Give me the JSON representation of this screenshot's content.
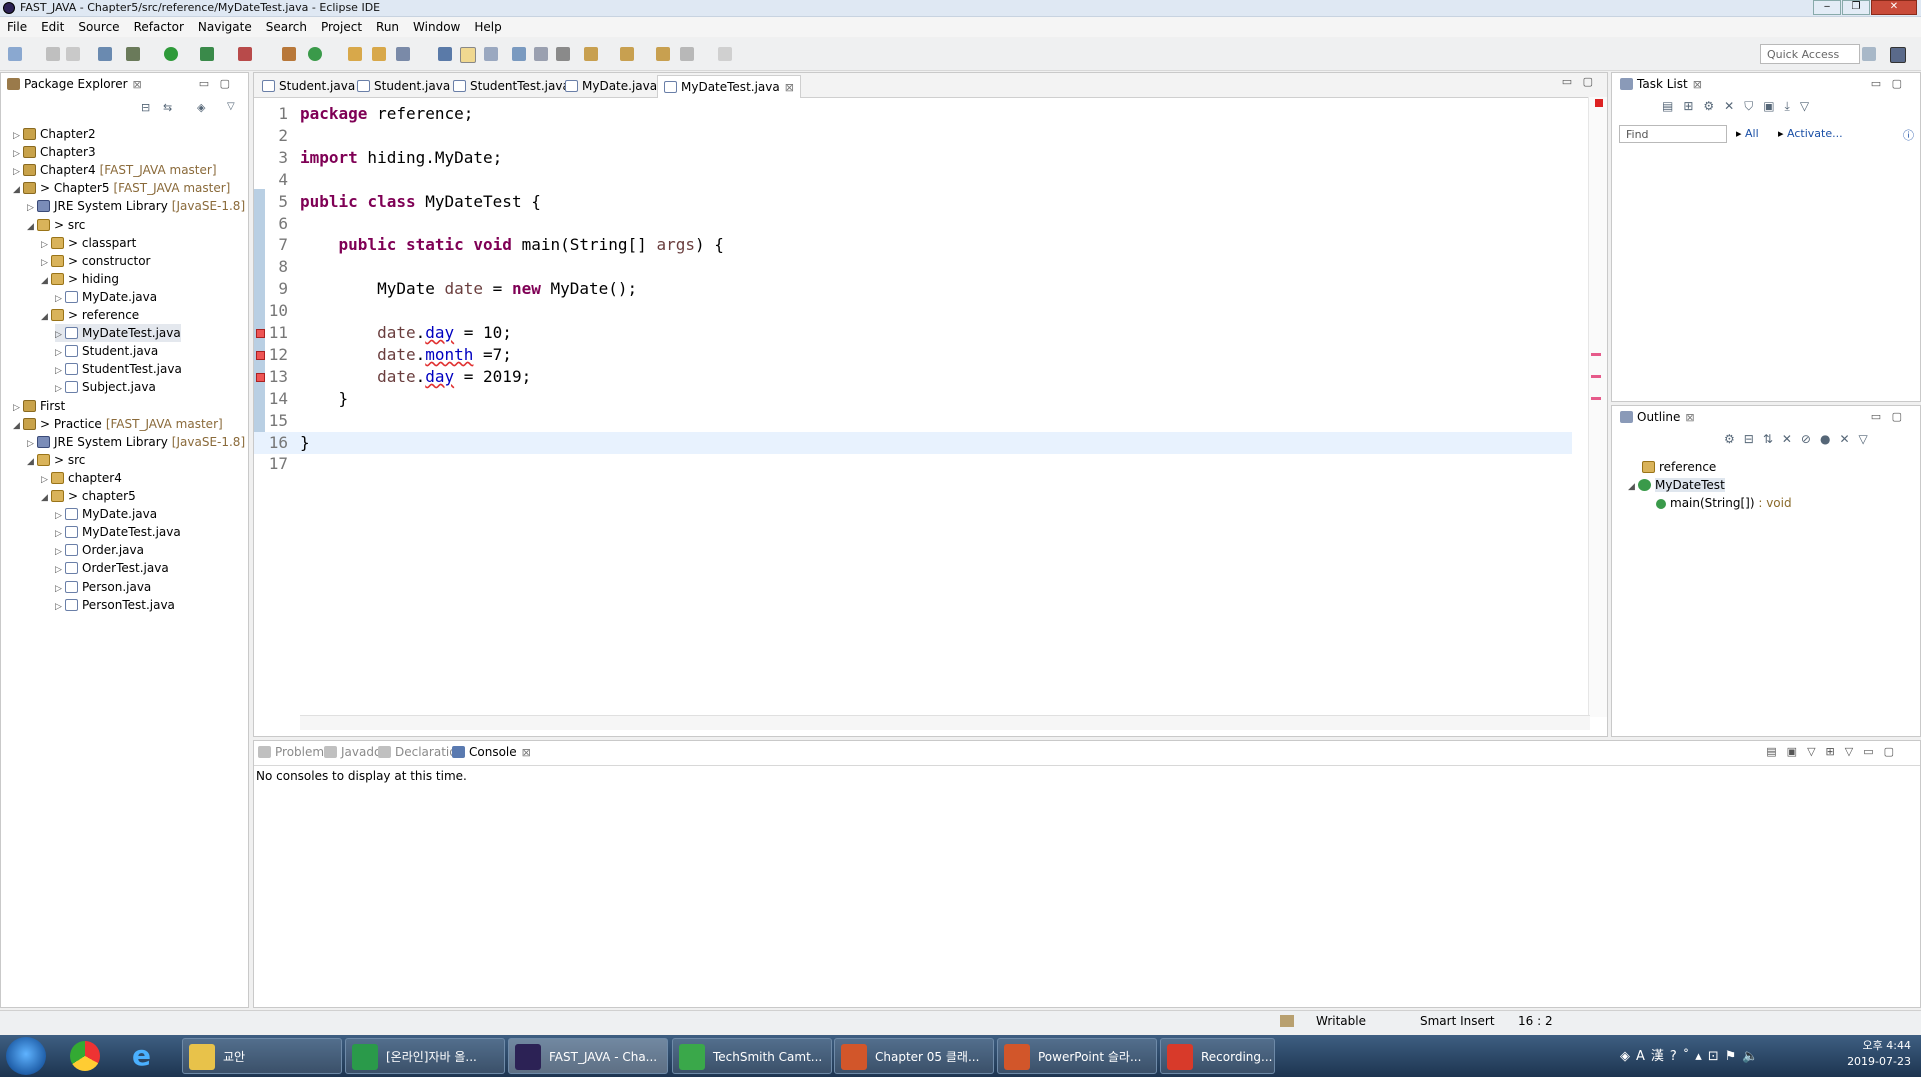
{
  "window": {
    "title": "FAST_JAVA - Chapter5/src/reference/MyDateTest.java - Eclipse IDE"
  },
  "menu": [
    "File",
    "Edit",
    "Source",
    "Refactor",
    "Navigate",
    "Search",
    "Project",
    "Run",
    "Window",
    "Help"
  ],
  "toolbar": {
    "quick_access": "Quick Access"
  },
  "package_explorer": {
    "title": "Package Explorer",
    "rows": [
      {
        "label": "Chapter2",
        "extra": "",
        "icon": "project-icon",
        "depth": 0,
        "twisty": "▷"
      },
      {
        "label": "Chapter3",
        "extra": "",
        "icon": "project-icon",
        "depth": 0,
        "twisty": "▷"
      },
      {
        "label": "Chapter4",
        "extra": "[FAST_JAVA master]",
        "icon": "project-icon",
        "depth": 0,
        "twisty": "▷"
      },
      {
        "label": "> Chapter5",
        "extra": "[FAST_JAVA master]",
        "icon": "project-icon",
        "depth": 0,
        "twisty": "◢"
      },
      {
        "label": "JRE System Library",
        "extra": "[JavaSE-1.8]",
        "icon": "library-icon",
        "depth": 1,
        "twisty": "▷"
      },
      {
        "label": "> src",
        "extra": "",
        "icon": "package-icon",
        "depth": 1,
        "twisty": "◢"
      },
      {
        "label": "> classpart",
        "extra": "",
        "icon": "package-icon",
        "depth": 2,
        "twisty": "▷"
      },
      {
        "label": "> constructor",
        "extra": "",
        "icon": "package-icon",
        "depth": 2,
        "twisty": "▷"
      },
      {
        "label": "> hiding",
        "extra": "",
        "icon": "package-icon",
        "depth": 2,
        "twisty": "◢"
      },
      {
        "label": "MyDate.java",
        "extra": "",
        "icon": "java-file-icon",
        "depth": 3,
        "twisty": "▷"
      },
      {
        "label": "> reference",
        "extra": "",
        "icon": "package-icon",
        "depth": 2,
        "twisty": "◢"
      },
      {
        "label": "MyDateTest.java",
        "extra": "",
        "icon": "java-file-icon",
        "depth": 3,
        "twisty": "▷"
      },
      {
        "label": "Student.java",
        "extra": "",
        "icon": "java-file-icon",
        "depth": 3,
        "twisty": "▷"
      },
      {
        "label": "StudentTest.java",
        "extra": "",
        "icon": "java-file-icon",
        "depth": 3,
        "twisty": "▷"
      },
      {
        "label": "Subject.java",
        "extra": "",
        "icon": "java-file-icon",
        "depth": 3,
        "twisty": "▷"
      },
      {
        "label": "First",
        "extra": "",
        "icon": "project-icon",
        "depth": 0,
        "twisty": "▷"
      },
      {
        "label": "> Practice",
        "extra": "[FAST_JAVA master]",
        "icon": "project-icon",
        "depth": 0,
        "twisty": "◢"
      },
      {
        "label": "JRE System Library",
        "extra": "[JavaSE-1.8]",
        "icon": "library-icon",
        "depth": 1,
        "twisty": "▷"
      },
      {
        "label": "> src",
        "extra": "",
        "icon": "package-icon",
        "depth": 1,
        "twisty": "◢"
      },
      {
        "label": "chapter4",
        "extra": "",
        "icon": "package-icon",
        "depth": 2,
        "twisty": "▷"
      },
      {
        "label": "> chapter5",
        "extra": "",
        "icon": "package-icon",
        "depth": 2,
        "twisty": "◢"
      },
      {
        "label": "MyDate.java",
        "extra": "",
        "icon": "java-file-icon",
        "depth": 3,
        "twisty": "▷"
      },
      {
        "label": "MyDateTest.java",
        "extra": "",
        "icon": "java-file-icon",
        "depth": 3,
        "twisty": "▷"
      },
      {
        "label": "Order.java",
        "extra": "",
        "icon": "java-file-icon",
        "depth": 3,
        "twisty": "▷"
      },
      {
        "label": "OrderTest.java",
        "extra": "",
        "icon": "java-file-icon",
        "depth": 3,
        "twisty": "▷"
      },
      {
        "label": "Person.java",
        "extra": "",
        "icon": "java-file-icon",
        "depth": 3,
        "twisty": "▷"
      },
      {
        "label": "PersonTest.java",
        "extra": "",
        "icon": "java-file-icon",
        "depth": 3,
        "twisty": "▷"
      }
    ]
  },
  "editor": {
    "tabs": [
      "Student.java",
      "Student.java",
      "StudentTest.java",
      "MyDate.java",
      "MyDateTest.java"
    ],
    "active_tab": 4,
    "current_line": 16,
    "lines": [
      [
        {
          "t": "package",
          "c": "kw"
        },
        {
          "t": " reference;",
          "c": ""
        }
      ],
      [],
      [
        {
          "t": "import",
          "c": "kw"
        },
        {
          "t": " hiding.MyDate;",
          "c": ""
        }
      ],
      [],
      [
        {
          "t": "public",
          "c": "kw"
        },
        {
          "t": " ",
          "c": ""
        },
        {
          "t": "class",
          "c": "kw"
        },
        {
          "t": " MyDateTest {",
          "c": ""
        }
      ],
      [],
      [
        {
          "t": "    ",
          "c": ""
        },
        {
          "t": "public",
          "c": "kw"
        },
        {
          "t": " ",
          "c": ""
        },
        {
          "t": "static",
          "c": "kw"
        },
        {
          "t": " ",
          "c": ""
        },
        {
          "t": "void",
          "c": "kw"
        },
        {
          "t": " main(String[] ",
          "c": ""
        },
        {
          "t": "args",
          "c": "var"
        },
        {
          "t": ") {",
          "c": ""
        }
      ],
      [],
      [
        {
          "t": "        MyDate ",
          "c": ""
        },
        {
          "t": "date",
          "c": "var"
        },
        {
          "t": " = ",
          "c": ""
        },
        {
          "t": "new",
          "c": "kw"
        },
        {
          "t": " MyDate();",
          "c": ""
        }
      ],
      [],
      [
        {
          "t": "        ",
          "c": ""
        },
        {
          "t": "date",
          "c": "var"
        },
        {
          "t": ".",
          "c": ""
        },
        {
          "t": "day",
          "c": "fld err"
        },
        {
          "t": " = 10;",
          "c": ""
        }
      ],
      [
        {
          "t": "        ",
          "c": ""
        },
        {
          "t": "date",
          "c": "var"
        },
        {
          "t": ".",
          "c": ""
        },
        {
          "t": "month",
          "c": "fld err"
        },
        {
          "t": " =7;",
          "c": ""
        }
      ],
      [
        {
          "t": "        ",
          "c": ""
        },
        {
          "t": "date",
          "c": "var"
        },
        {
          "t": ".",
          "c": ""
        },
        {
          "t": "day",
          "c": "fld err"
        },
        {
          "t": " = 2019;",
          "c": ""
        }
      ],
      [
        {
          "t": "    }",
          "c": ""
        }
      ],
      [],
      [
        {
          "t": "}",
          "c": ""
        }
      ],
      []
    ],
    "error_lines": [
      11,
      12,
      13
    ]
  },
  "task_list": {
    "title": "Task List",
    "find_placeholder": "Find",
    "all": "All",
    "activate": "Activate..."
  },
  "outline": {
    "title": "Outline",
    "items": [
      {
        "label": "reference",
        "suffix": ""
      },
      {
        "label": "MyDateTest",
        "suffix": ""
      },
      {
        "label": "main(String[])",
        "suffix": " : void"
      }
    ]
  },
  "console": {
    "tabs": [
      "Problems",
      "Javadoc",
      "Declaration",
      "Console"
    ],
    "active_tab": 3,
    "message": "No consoles to display at this time."
  },
  "status": {
    "writable": "Writable",
    "insert": "Smart Insert",
    "position": "16 : 2"
  },
  "taskbar": {
    "apps": [
      {
        "label": "교안",
        "color": "#e8c24a"
      },
      {
        "label": "[온라인]자바 올...",
        "color": "#2a9a4a"
      },
      {
        "label": "FAST_JAVA - Cha...",
        "color": "#2c2255"
      },
      {
        "label": "TechSmith Camt...",
        "color": "#3aa84a"
      },
      {
        "label": "Chapter 05 클래...",
        "color": "#d2562a"
      },
      {
        "label": "PowerPoint 슬라...",
        "color": "#d2562a"
      },
      {
        "label": "Recording...",
        "color": "#d83a2a"
      }
    ],
    "time": "오후 4:44",
    "date": "2019-07-23"
  }
}
